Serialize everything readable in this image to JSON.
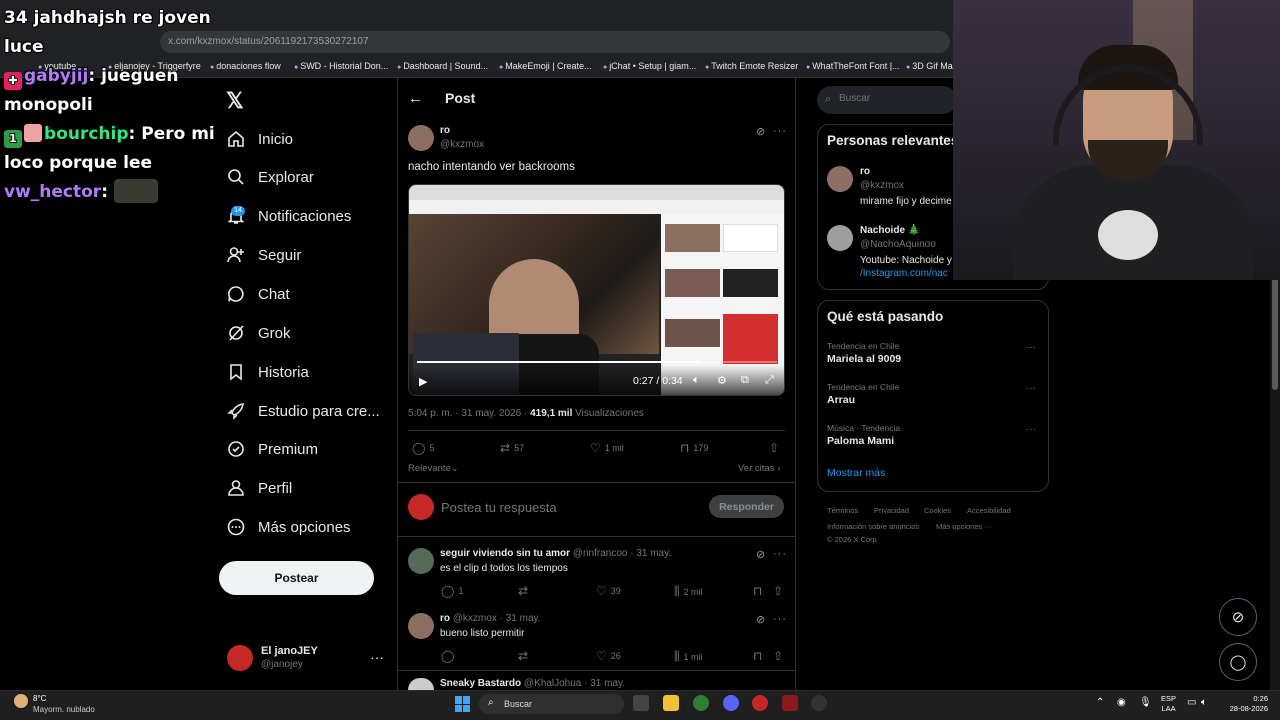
{
  "browser": {
    "url": "x.com/kxzmox/status/2061192173530272107",
    "bookmarks": [
      "youtube",
      "eljanojey - Triggerfyre",
      "donaciones flow",
      "SWD - Historial Don...",
      "Dashboard | Sound...",
      "MakeEmoji | Create...",
      "jChat • Setup | giam...",
      "Twitch Emote Resizer",
      "WhatTheFont Font |...",
      "3D Gif Ma..."
    ]
  },
  "chat_overlay": {
    "line1": "34 jahdhajsh re joven luce",
    "msg2_user": "gabyjij",
    "msg2_text": " jueguen monopoli",
    "msg3_user": "bourchip",
    "msg3_text": " Pero mi loco porque lee",
    "msg4_user": "vw_hector",
    "colon": ":"
  },
  "nav": {
    "items": [
      "Inicio",
      "Explorar",
      "Notificaciones",
      "Seguir",
      "Chat",
      "Grok",
      "Historia",
      "Estudio para cre...",
      "Premium",
      "Perfil",
      "Más opciones"
    ],
    "notif_count": "14",
    "post_button": "Postear",
    "me_name": "El janoJEY",
    "me_handle": "@janojey",
    "me_more": "···"
  },
  "post": {
    "header_title": "Post",
    "author_name": "ro",
    "author_handle": "@kxzmox",
    "text": "nacho intentando ver backrooms",
    "video_time": "0:27 / 0:34",
    "video_progress": 0.79,
    "timestamp": "5:04 p. m. · 31 may. 2026 · ",
    "views_count": "419,1 mil",
    "views_label": " Visualizaciones",
    "replies": "5",
    "reposts": "57",
    "likes": "1 mil",
    "bookmarks": "179",
    "sort_label": "Relevante",
    "quotes_label": "Ver citas",
    "reply_placeholder": "Postea tu respuesta",
    "reply_button": "Responder"
  },
  "replies": [
    {
      "name": "seguir viviendo sin tu amor",
      "meta": " @nnfrancoo · 31 may.",
      "text": "es el clip d todos los tiempos",
      "replies": "1",
      "reposts": "",
      "likes": "39",
      "views": "2 mil"
    },
    {
      "name": "ro",
      "meta": " @kxzmox · 31 may.",
      "text": "bueno listo permitir",
      "replies": "",
      "reposts": "",
      "likes": "26",
      "views": "1 mil"
    },
    {
      "name": "Sneaky Bastardo",
      "meta": " @KhalJohua · 31 may."
    }
  ],
  "sidebar": {
    "search_placeholder": "Buscar",
    "relevant_title": "Personas relevantes",
    "people": [
      {
        "name": "ro",
        "handle": "@kxzmox",
        "bio": "mirame fijo y decime"
      },
      {
        "name": "Nachoide 🎄",
        "handle": "@NachoAquinoo",
        "bio": "Youtube: Nachoide y",
        "bio_link": "/Instagram.com/nac"
      }
    ],
    "trends_title": "Qué está pasando",
    "trends": [
      {
        "category": "Tendencia en Chile",
        "name": "Mariela al 9009"
      },
      {
        "category": "Tendencia en Chile",
        "name": "Arrau"
      },
      {
        "category": "Música · Tendencia",
        "name": "Paloma Mami"
      }
    ],
    "trend_more": "···",
    "show_more": "Mostrar más",
    "footer": [
      "Términos",
      "Privacidad",
      "Cookies",
      "Accesibilidad",
      "Información sobre anuncios",
      "Más opciones ···",
      "© 2026 X Corp."
    ]
  },
  "taskbar": {
    "temp": "8°C",
    "weather": "Mayorm. nublado",
    "search_label": "Buscar",
    "lang1": "ESP",
    "lang2": "LAA",
    "time": "0:26",
    "date": "28-08-2026"
  },
  "colors": {
    "accent": "#1d9bf0",
    "background": "#000000",
    "chat_purple": "#b27bff",
    "chat_green": "#2fe87d"
  }
}
